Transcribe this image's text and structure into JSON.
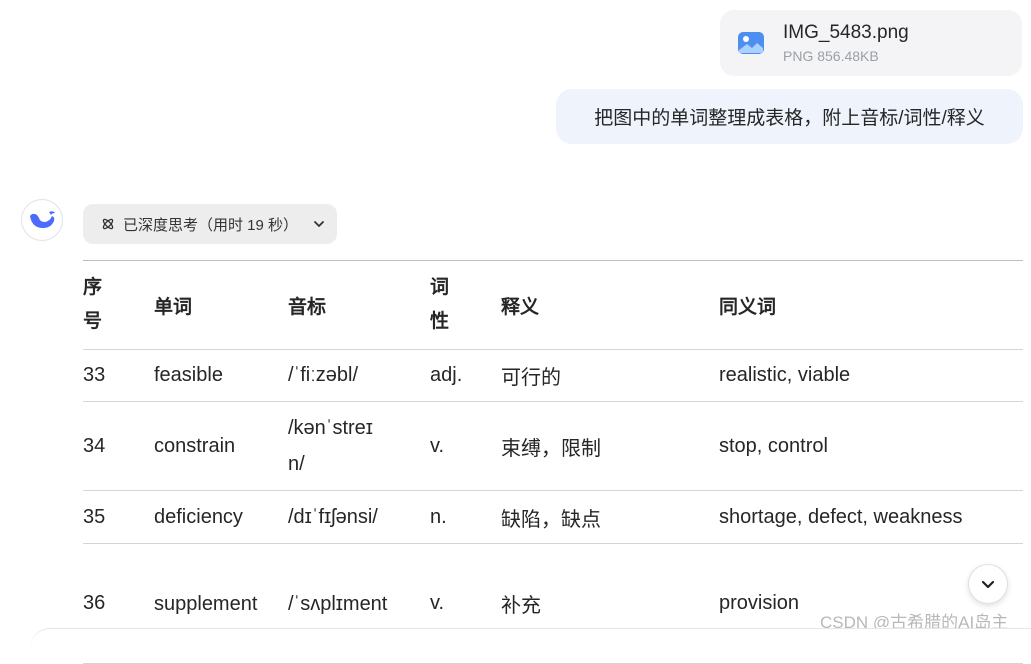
{
  "attachment": {
    "file_name": "IMG_5483.png",
    "file_meta": "PNG 856.48KB",
    "icon": "image-file-icon"
  },
  "user_message": "把图中的单词整理成表格，附上音标/词性/释义",
  "assistant": {
    "avatar_icon": "deepseek-whale-icon",
    "thinking_label": "已深度思考（用时 19 秒）",
    "thinking_icon": "atom-icon",
    "expand_icon": "chevron-down-icon"
  },
  "table": {
    "headers": [
      "序号",
      "单词",
      "音标",
      "词性",
      "释义",
      "同义词"
    ],
    "rows": [
      [
        "33",
        "feasible",
        "/ˈfiːzəbl/",
        "adj.",
        "可行的",
        "realistic, viable"
      ],
      [
        "34",
        "constrain",
        "/kənˈstreɪn/",
        "v.",
        "束缚，限制",
        "stop, control"
      ],
      [
        "35",
        "deficiency",
        "/dɪˈfɪʃənsi/",
        "n.",
        "缺陷，缺点",
        "shortage, defect, weakness"
      ],
      [
        "36",
        "supplement",
        "/ˈsʌplɪment",
        "v.",
        "补充",
        "provision"
      ]
    ]
  },
  "scroll_button_icon": "chevron-down-icon",
  "watermark": "CSDN @古希腊的AI岛主",
  "colors": {
    "accent": "#4d6bfe",
    "user_bubble_bg": "#eef3fc",
    "pill_bg": "#ededed"
  }
}
